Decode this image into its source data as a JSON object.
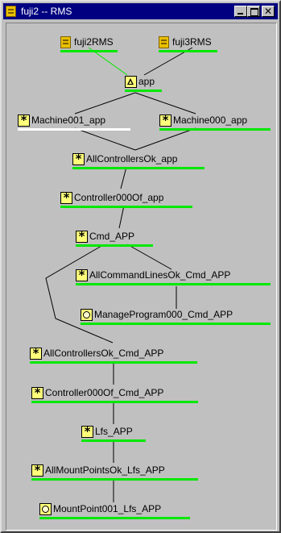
{
  "window": {
    "title": "fuji2 -- RMS",
    "icon": "rms-host-icon",
    "buttons": [
      "minimize",
      "maximize",
      "close"
    ],
    "close_glyph": "✕"
  },
  "graph": {
    "colors": {
      "online_underline": "#00e800",
      "offline_underline": "#ffffff",
      "node_icon_fill": "#ffff7a",
      "host_icon_fill": "#e8c000",
      "edge_host_link": "#00e800",
      "edge_default": "#000000"
    },
    "nodes": [
      {
        "id": "fuji2RMS",
        "label": "fuji2RMS",
        "icon": "host-icon",
        "state": "online"
      },
      {
        "id": "fuji3RMS",
        "label": "fuji3RMS",
        "icon": "host-icon",
        "state": "online"
      },
      {
        "id": "app",
        "label": "app",
        "icon": "userapp-triangle-icon",
        "state": "online"
      },
      {
        "id": "Machine001_app",
        "label": "Machine001_app",
        "icon": "asterisk-icon",
        "state": "offline"
      },
      {
        "id": "Machine000_app",
        "label": "Machine000_app",
        "icon": "asterisk-icon",
        "state": "online"
      },
      {
        "id": "AllControllersOk_app",
        "label": "AllControllersOk_app",
        "icon": "asterisk-icon",
        "state": "online"
      },
      {
        "id": "Controller000Of_app",
        "label": "Controller000Of_app",
        "icon": "asterisk-icon",
        "state": "online"
      },
      {
        "id": "Cmd_APP",
        "label": "Cmd_APP",
        "icon": "asterisk-icon",
        "state": "online"
      },
      {
        "id": "AllCommandLinesOk_Cmd_APP",
        "label": "AllCommandLinesOk_Cmd_APP",
        "icon": "asterisk-icon",
        "state": "online"
      },
      {
        "id": "ManageProgram000_Cmd_APP",
        "label": "ManageProgram000_Cmd_APP",
        "icon": "circle-icon",
        "state": "online"
      },
      {
        "id": "AllControllersOk_Cmd_APP",
        "label": "AllControllersOk_Cmd_APP",
        "icon": "asterisk-icon",
        "state": "online"
      },
      {
        "id": "Controller000Of_Cmd_APP",
        "label": "Controller000Of_Cmd_APP",
        "icon": "asterisk-icon",
        "state": "online"
      },
      {
        "id": "Lfs_APP",
        "label": "Lfs_APP",
        "icon": "asterisk-icon",
        "state": "online"
      },
      {
        "id": "AllMountPointsOk_Lfs_APP",
        "label": "AllMountPointsOk_Lfs_APP",
        "icon": "asterisk-icon",
        "state": "online"
      },
      {
        "id": "MountPoint001_Lfs_APP",
        "label": "MountPoint001_Lfs_APP",
        "icon": "circle-icon",
        "state": "online"
      }
    ],
    "edges": [
      {
        "from": "fuji2RMS",
        "to": "app",
        "kind": "host_link"
      },
      {
        "from": "fuji3RMS",
        "to": "app",
        "kind": "default"
      },
      {
        "from": "app",
        "to": "Machine001_app",
        "kind": "default"
      },
      {
        "from": "app",
        "to": "Machine000_app",
        "kind": "default"
      },
      {
        "from": "Machine001_app",
        "to": "AllControllersOk_app",
        "kind": "default"
      },
      {
        "from": "Machine000_app",
        "to": "AllControllersOk_app",
        "kind": "default"
      },
      {
        "from": "AllControllersOk_app",
        "to": "Controller000Of_app",
        "kind": "default"
      },
      {
        "from": "Controller000Of_app",
        "to": "Cmd_APP",
        "kind": "default"
      },
      {
        "from": "Cmd_APP",
        "to": "AllCommandLinesOk_Cmd_APP",
        "kind": "default"
      },
      {
        "from": "AllCommandLinesOk_Cmd_APP",
        "to": "ManageProgram000_Cmd_APP",
        "kind": "default"
      },
      {
        "from": "Cmd_APP",
        "to": "AllControllersOk_Cmd_APP",
        "kind": "default"
      },
      {
        "from": "AllControllersOk_Cmd_APP",
        "to": "Controller000Of_Cmd_APP",
        "kind": "default"
      },
      {
        "from": "Controller000Of_Cmd_APP",
        "to": "Lfs_APP",
        "kind": "default"
      },
      {
        "from": "Lfs_APP",
        "to": "AllMountPointsOk_Lfs_APP",
        "kind": "default"
      },
      {
        "from": "AllMountPointsOk_Lfs_APP",
        "to": "MountPoint001_Lfs_APP",
        "kind": "default"
      }
    ]
  }
}
